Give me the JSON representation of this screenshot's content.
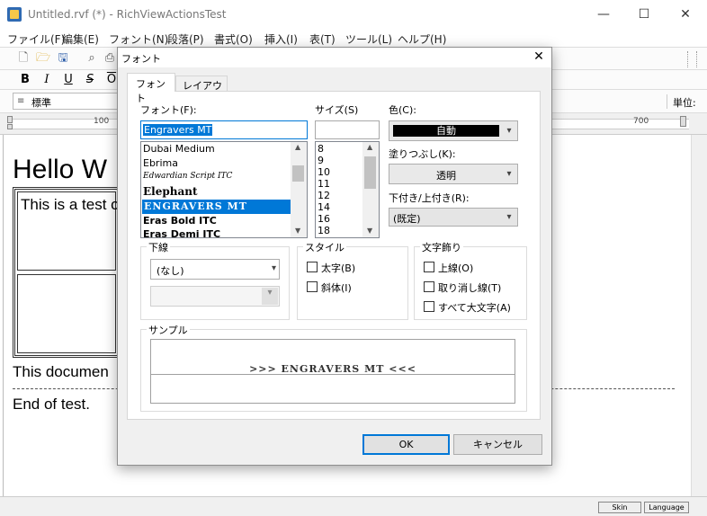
{
  "app": {
    "title": "Untitled.rvf (*) - RichViewActionsTest",
    "minimize": "—",
    "maximize": "☐",
    "close": "✕"
  },
  "menu": [
    "ファイル(F)",
    "編集(E)",
    "フォント(N)",
    "段落(P)",
    "書式(O)",
    "挿入(I)",
    "表(T)",
    "ツール(L)",
    "ヘルプ(H)"
  ],
  "toolbar": {
    "style_value": "標準",
    "unit_label": "単位:",
    "format_buttons": [
      "B",
      "I",
      "U",
      "S",
      "O"
    ]
  },
  "ruler": {
    "ticks": [
      "100",
      "700"
    ]
  },
  "document": {
    "heading": "Hello W",
    "cell_text": "This is a test o",
    "para1": "This documen",
    "para2": "End of test."
  },
  "status": {
    "skin": "Skin",
    "language": "Language"
  },
  "dialog": {
    "title": "フォント",
    "close": "✕",
    "tabs": [
      "フォント",
      "レイアウト"
    ],
    "font_label": "フォント(F):",
    "font_value": "Engravers MT",
    "font_list": [
      "Dubai Medium",
      "Ebrima",
      "Edwardian Script ITC",
      "Elephant",
      "ENGRAVERS MT",
      "Eras Bold ITC",
      "Eras Demi ITC"
    ],
    "size_label": "サイズ(S)",
    "size_value": "",
    "size_list": [
      "8",
      "9",
      "10",
      "11",
      "12",
      "14",
      "16",
      "18"
    ],
    "color_label": "色(C):",
    "color_value": "自動",
    "fill_label": "塗りつぶし(K):",
    "fill_value": "透明",
    "subsup_label": "下付き/上付き(R):",
    "subsup_value": "(既定)",
    "underline_group": "下線",
    "underline_value": "(なし)",
    "underline_color_value": "",
    "style_group": "スタイル",
    "bold_label": "太字(B)",
    "italic_label": "斜体(I)",
    "effects_group": "文字飾り",
    "overline_label": "上線(O)",
    "strike_label": "取り消し線(T)",
    "allcaps_label": "すべて大文字(A)",
    "sample_group": "サンプル",
    "sample_text": ">>>  ENGRAVERS MT  <<<",
    "ok": "OK",
    "cancel": "キャンセル",
    "colors": {
      "accent": "#0078d7",
      "selection": "#0078d7"
    }
  }
}
